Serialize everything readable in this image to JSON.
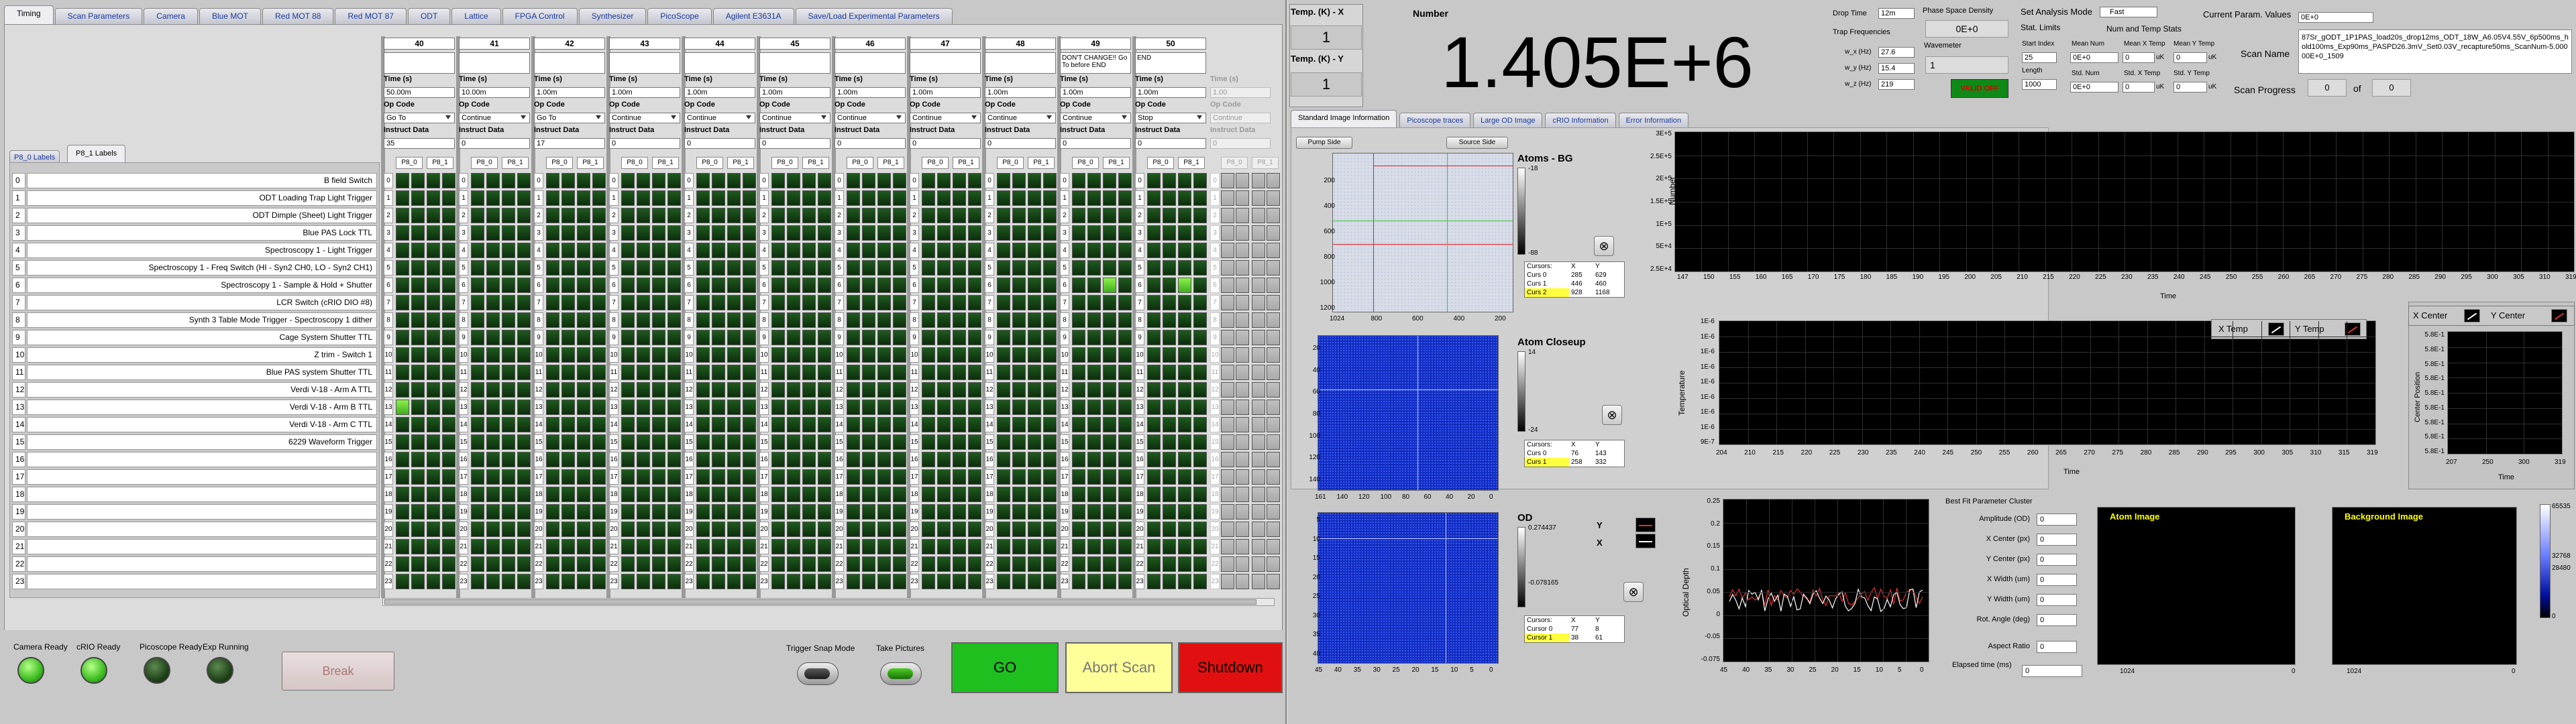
{
  "left_tabs": [
    "Timing",
    "Scan Parameters",
    "Camera",
    "Blue MOT",
    "Red MOT 88",
    "Red MOT 87",
    "ODT",
    "Lattice",
    "FPGA Control",
    "Synthesizer",
    "PicoScope",
    "Agilent E3631A",
    "Save/Load Experimental Parameters"
  ],
  "sub_tabs": [
    "P8_0 Labels",
    "P8_1 Labels"
  ],
  "step_headers": {
    "time": "Time (s)",
    "opcode": "Op Code",
    "instruct": "Instruct Data"
  },
  "steps": [
    {
      "num": "40",
      "note": "",
      "time": "50.00m",
      "opcode": "Go To",
      "instruct": "35"
    },
    {
      "num": "41",
      "note": "",
      "time": "10.00m",
      "opcode": "Continue",
      "instruct": "0"
    },
    {
      "num": "42",
      "note": "",
      "time": "1.00m",
      "opcode": "Go To",
      "instruct": "17"
    },
    {
      "num": "43",
      "note": "",
      "time": "1.00m",
      "opcode": "Continue",
      "instruct": "0"
    },
    {
      "num": "44",
      "note": "",
      "time": "1.00m",
      "opcode": "Continue",
      "instruct": "0"
    },
    {
      "num": "45",
      "note": "",
      "time": "1.00m",
      "opcode": "Continue",
      "instruct": "0"
    },
    {
      "num": "46",
      "note": "",
      "time": "1.00m",
      "opcode": "Continue",
      "instruct": "0"
    },
    {
      "num": "47",
      "note": "",
      "time": "1.00m",
      "opcode": "Continue",
      "instruct": "0"
    },
    {
      "num": "48",
      "note": "",
      "time": "1.00m",
      "opcode": "Continue",
      "instruct": "0"
    },
    {
      "num": "49",
      "note": "DON'T CHANGE!! Go To before END",
      "time": "1.00m",
      "opcode": "Continue",
      "instruct": "0"
    },
    {
      "num": "50",
      "note": "END",
      "time": "1.00m",
      "opcode": "Stop",
      "instruct": "0"
    }
  ],
  "ghost_step": {
    "time": "Time (s)",
    "time_val": "1.00",
    "opcode": "Op Code",
    "opcode_val": "Continue",
    "instruct": "Instruct Data",
    "instruct_val": "0"
  },
  "port_labels": [
    "P8_0",
    "P8_1"
  ],
  "channels": [
    "B field Switch",
    "ODT Loading Trap Light Trigger",
    "ODT Dimple (Sheet) Light Trigger",
    "Blue PAS Lock TTL",
    "Spectroscopy 1 - Light Trigger",
    "Spectroscopy 1 - Freq Switch (HI - Syn2 CH0, LO - Syn2 CH1)",
    "Spectroscopy 1 - Sample & Hold + Shutter",
    "LCR Switch (cRIO DIO #8)",
    "Synth 3 Table Mode Trigger - Spectroscopy 1 dither",
    "Cage System Shutter TTL",
    "Z trim - Switch 1",
    "Blue PAS system Shutter TTL",
    "Verdi V-18 - Arm A TTL",
    "Verdi V-18 - Arm B TTL",
    "Verdi V-18 - Arm C TTL",
    "6229 Waveform Trigger",
    "",
    "",
    "",
    "",
    "",
    "",
    "",
    ""
  ],
  "channel_indices": [
    "0",
    "1",
    "2",
    "3",
    "4",
    "5",
    "6",
    "7",
    "8",
    "9",
    "10",
    "11",
    "12",
    "13",
    "14",
    "15",
    "16",
    "17",
    "18",
    "19",
    "20",
    "21",
    "22",
    "23"
  ],
  "status_leds": [
    {
      "label": "Camera Ready",
      "on": true
    },
    {
      "label": "cRIO Ready",
      "on": true
    },
    {
      "label": "Picoscope Ready",
      "on": false
    },
    {
      "label": "Exp Running",
      "on": false
    }
  ],
  "bottom": {
    "break": "Break",
    "trigger_snap": "Trigger Snap Mode",
    "take_pictures": "Take Pictures",
    "go": "GO",
    "abort": "Abort Scan",
    "shutdown": "Shutdown"
  },
  "temps": {
    "x_label": "Temp. (K) - X",
    "x_value": "1",
    "y_label": "Temp. (K) - Y",
    "y_value": "1"
  },
  "number": {
    "label": "Number",
    "value": "1.405E+6"
  },
  "drop": {
    "label": "Drop Time",
    "value": "12m",
    "trap_freq": "Trap Frequencies",
    "wx_label": "w_x (Hz)",
    "wx": "27.6",
    "wy_label": "w_y (Hz)",
    "wy": "15.4",
    "wz_label": "w_z (Hz)",
    "wz": "219"
  },
  "psd": {
    "label": "Phase Space Density",
    "value": "0E+0",
    "wavemeter": "Wavemeter",
    "wm_value": "1",
    "ok": "VALID OFF"
  },
  "analysis": {
    "label": "Set Analysis Mode",
    "mode": "Fast",
    "stat_limits": "Stat. Limits",
    "start_index": "Start Index",
    "start_val": "25",
    "length": "Length",
    "length_val": "1000",
    "num_temp": "Num and Temp Stats",
    "mean_num": "Mean Num",
    "mean_num_val": "0E+0",
    "mean_x": "Mean X Temp",
    "mean_x_val": "0",
    "mean_y": "Mean Y Temp",
    "mean_y_val": "0",
    "std_num": "Std. Num",
    "std_num_val": "0E+0",
    "std_x": "Std. X Temp",
    "std_x_val": "0",
    "std_y": "Std. Y Temp",
    "std_y_val": "0",
    "unit": "uK"
  },
  "current_param": {
    "label": "Current Param. Values",
    "value": "0E+0"
  },
  "scan_name": {
    "label": "Scan Name",
    "value": "87Sr_gODT_1P1PAS_load20s_drop12ms_ODT_18W_A6.05V4.55V_6p500ms_hold100ms_Exp90ms_PASPD26.3mV_Set0.03V_recapture50ms_ScanNum-5.00000E+0_1509"
  },
  "scan_progress": {
    "label": "Scan Progress",
    "current": "0",
    "of": "of",
    "total": "0"
  },
  "right_tabs": [
    "Standard Image Information",
    "Picoscope traces",
    "Large OD Image",
    "cRIO Information",
    "Error Information"
  ],
  "pump_side": "Pump Side",
  "source_side": "Source Side",
  "atoms_bg": {
    "title": "Atoms - BG",
    "cb_top": "-18",
    "cb_bot": "-88",
    "y_ticks": [
      "200",
      "400",
      "600",
      "800",
      "1000",
      "1200"
    ],
    "x_ticks": [
      "1024",
      "800",
      "600",
      "400",
      "200"
    ],
    "cursors": [
      {
        "name": "Curs 0",
        "x": "285",
        "y": "629"
      },
      {
        "name": "Curs 1",
        "x": "446",
        "y": "460"
      },
      {
        "name": "Curs 2",
        "x": "928",
        "y": "1168"
      }
    ]
  },
  "closeup": {
    "title": "Atom Closeup",
    "cb_top": "14",
    "cb_bot": "-24",
    "y_ticks": [
      "20",
      "40",
      "60",
      "80",
      "100",
      "120",
      "140"
    ],
    "x_ticks": [
      "161",
      "140",
      "120",
      "100",
      "80",
      "60",
      "40",
      "20",
      "0"
    ],
    "cursors": [
      {
        "name": "Curs 0",
        "x": "76",
        "y": "143"
      },
      {
        "name": "Curs 1",
        "x": "258",
        "y": "332"
      }
    ]
  },
  "od": {
    "title": "OD",
    "cb_top": "0.274437",
    "cb_bot": "-0.078165",
    "y_ticks": [
      "5",
      "10",
      "15",
      "20",
      "25",
      "30",
      "35",
      "40"
    ],
    "x_ticks": [
      "45",
      "40",
      "35",
      "30",
      "25",
      "20",
      "15",
      "10",
      "5",
      "0"
    ],
    "cursors": [
      {
        "name": "Cursor 0",
        "x": "77",
        "y": "8"
      },
      {
        "name": "Cursor 1",
        "x": "38",
        "y": "61"
      }
    ],
    "ylabel": "Y",
    "xlabel": "X"
  },
  "cursor_header": {
    "name": "Cursors:",
    "x": "X",
    "y": "Y"
  },
  "number_plot": {
    "ylabel": "Number",
    "xlabel": "Time",
    "y_ticks": [
      "3E+5",
      "2.5E+5",
      "2E+5",
      "1.5E+5",
      "1E+5",
      "5E+4",
      "2.5E+4"
    ],
    "x_ticks": [
      "147",
      "150",
      "155",
      "160",
      "165",
      "170",
      "175",
      "180",
      "185",
      "190",
      "195",
      "200",
      "205",
      "210",
      "215",
      "220",
      "225",
      "230",
      "235",
      "240",
      "245",
      "250",
      "255",
      "260",
      "265",
      "270",
      "275",
      "280",
      "285",
      "290",
      "295",
      "300",
      "305",
      "310",
      "319"
    ]
  },
  "temp_plot": {
    "ylabel": "Temperature",
    "xlabel": "Time",
    "y_ticks": [
      "1E-6",
      "1E-6",
      "1E-6",
      "1E-6",
      "1E-6",
      "1E-6",
      "1E-6",
      "1E-6",
      "9E-7"
    ],
    "x_ticks": [
      "204",
      "210",
      "215",
      "220",
      "225",
      "230",
      "235",
      "240",
      "245",
      "250",
      "255",
      "260",
      "265",
      "270",
      "275",
      "280",
      "285",
      "290",
      "295",
      "300",
      "305",
      "310",
      "315",
      "319"
    ],
    "legend_x": "X Temp",
    "legend_y": "Y Temp"
  },
  "center_plot": {
    "ylabel": "Center Position",
    "xlabel": "Time",
    "y_ticks": [
      "5.8E-1",
      "5.8E-1",
      "5.8E-1",
      "5.8E-1",
      "5.8E-1",
      "5.8E-1",
      "5.8E-1",
      "5.8E-1",
      "5.8E-1"
    ],
    "x_ticks": [
      "207",
      "250",
      "300",
      "319"
    ],
    "legend_x": "X Center",
    "legend_y": "Y Center"
  },
  "od_plot": {
    "ylabel": "Optical Depth",
    "y_ticks": [
      "0.25",
      "0.2",
      "0.15",
      "0.1",
      "0.05",
      "0",
      "-0.05",
      "-0.075"
    ],
    "x_ticks": [
      "45",
      "40",
      "35",
      "30",
      "25",
      "20",
      "15",
      "10",
      "5",
      "0"
    ]
  },
  "fit": {
    "title": "Best Fit Parameter Cluster",
    "rows": [
      {
        "label": "Amplitude (OD)",
        "value": "0"
      },
      {
        "label": "X Center (px)",
        "value": "0"
      },
      {
        "label": "Y Center (px)",
        "value": "0"
      },
      {
        "label": "X Width (um)",
        "value": "0"
      },
      {
        "label": "Y Width (um)",
        "value": "0"
      },
      {
        "label": "Rot. Angle (deg)",
        "value": "0"
      },
      {
        "label": "Aspect Ratio",
        "value": "0"
      }
    ],
    "elapsed_label": "Elapsed time (ms)",
    "elapsed": "0"
  },
  "atom_image": {
    "title": "Atom Image",
    "x0": "0",
    "x1": "1024"
  },
  "background_image": {
    "title": "Background Image",
    "x0": "0",
    "x1": "1024"
  },
  "right_colorbar": {
    "top": "65535",
    "mid": "32768",
    "val": "28480",
    "bot": "0"
  },
  "colors": {
    "go": "#1fbf1f",
    "abort": "#ffff99",
    "shutdown": "#e01010",
    "led_on": "#3cbd20",
    "panel": "#c8c8c8"
  }
}
